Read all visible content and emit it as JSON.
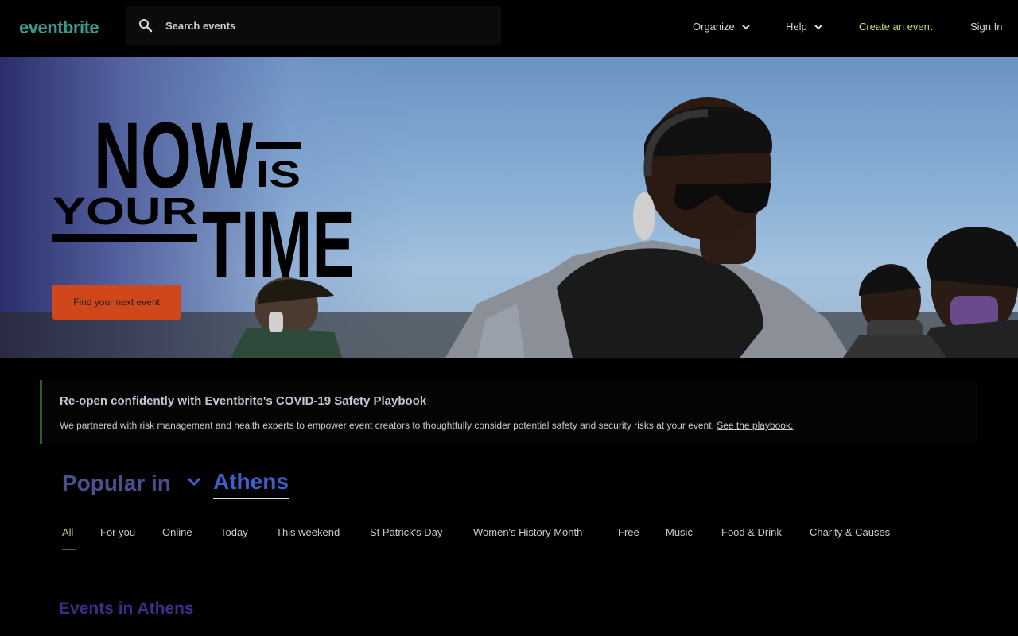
{
  "header": {
    "logo": "eventbrite",
    "search_placeholder": "Search events",
    "nav": {
      "organize": "Organize",
      "help": "Help",
      "create": "Create an event",
      "signin": "Sign In"
    }
  },
  "hero": {
    "headline_line1": "NOW",
    "headline_is": "IS",
    "headline_your": "YOUR",
    "headline_time": "TIME",
    "cta": "Find your next event"
  },
  "banner": {
    "title": "Re-open confidently with Eventbrite's COVID-19 Safety Playbook",
    "text": "We partnered with risk management and health experts to empower event creators to thoughtfully consider potential safety and security risks at your event.",
    "link": "See the playbook."
  },
  "popular": {
    "label": "Popular in",
    "city": "Athens"
  },
  "tabs": [
    "All",
    "For you",
    "Online",
    "Today",
    "This weekend",
    "St Patrick's Day",
    "Women's History Month",
    "Free",
    "Music",
    "Food & Drink",
    "Charity & Causes"
  ],
  "events_title": "Events in Athens",
  "colors": {
    "accent": "#d0471c",
    "create_link": "#cfd86a",
    "city": "#3d61c9"
  }
}
